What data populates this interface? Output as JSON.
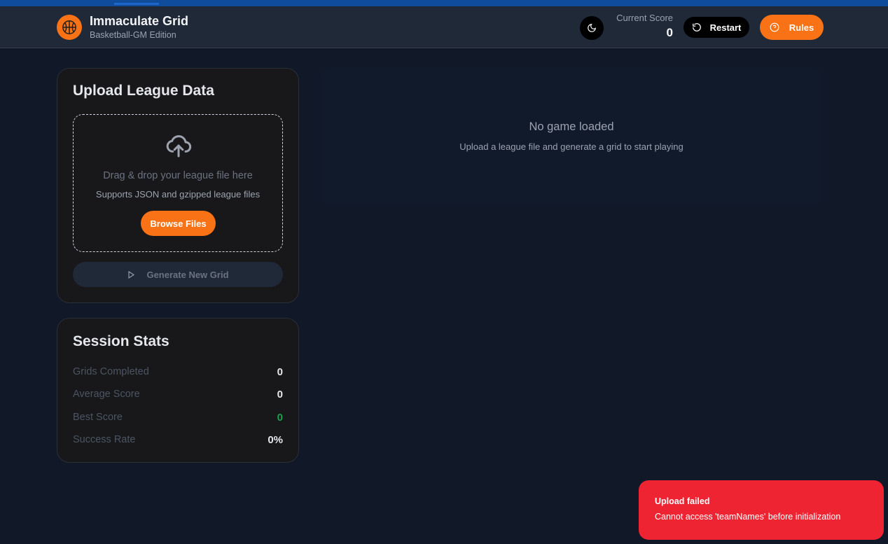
{
  "header": {
    "title": "Immaculate Grid",
    "subtitle": "Basketball-GM Edition",
    "score_label": "Current Score",
    "score_value": "0",
    "restart_label": "Restart",
    "rules_label": "Rules",
    "logo_icon": "basketball-icon",
    "theme_icon": "moon-icon",
    "accent_color": "#f97316"
  },
  "upload": {
    "title": "Upload League Data",
    "drop_text": "Drag & drop your league file here",
    "drop_subtext": "Supports JSON and gzipped league files",
    "browse_label": "Browse Files",
    "generate_label": "Generate New Grid",
    "upload_icon": "cloud-upload-icon",
    "generate_icon": "play-icon"
  },
  "stats": {
    "title": "Session Stats",
    "rows": [
      {
        "label": "Grids Completed",
        "value": "0"
      },
      {
        "label": "Average Score",
        "value": "0"
      },
      {
        "label": "Best Score",
        "value": "0"
      },
      {
        "label": "Success Rate",
        "value": "0%"
      }
    ]
  },
  "main": {
    "empty_title": "No game loaded",
    "empty_subtitle": "Upload a league file and generate a grid to start playing"
  },
  "toast": {
    "title": "Upload failed",
    "message": "Cannot access 'teamNames' before initialization",
    "color": "#ef2433"
  }
}
